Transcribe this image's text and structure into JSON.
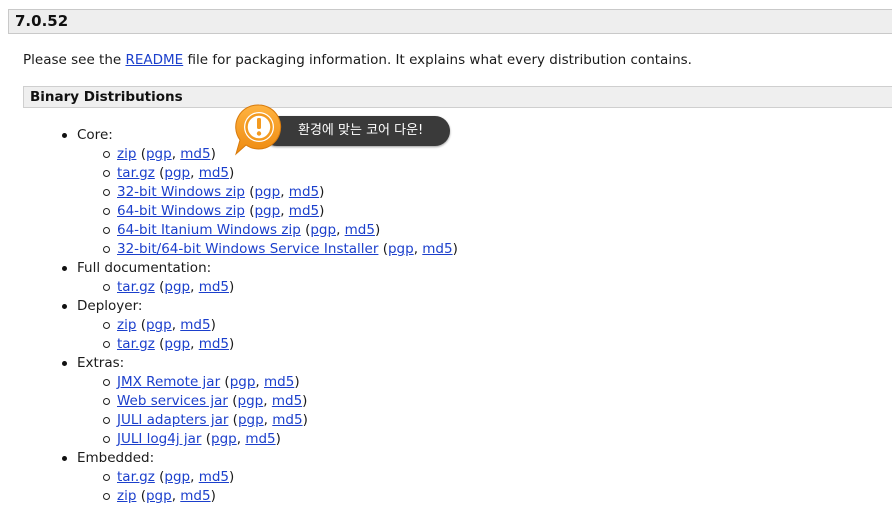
{
  "version_title": "7.0.52",
  "intro": {
    "before": "Please see the ",
    "link": "README",
    "after": " file for packaging information. It explains what every distribution contains."
  },
  "section_title": "Binary Distributions",
  "callout": {
    "text": "환경에 맞는 코어 다운!",
    "icon": "exclamation-icon",
    "accent": "#f39a1f"
  },
  "groups": [
    {
      "label": "Core:",
      "items": [
        {
          "name": "zip",
          "sig1": "pgp",
          "sig2": "md5"
        },
        {
          "name": "tar.gz",
          "sig1": "pgp",
          "sig2": "md5"
        },
        {
          "name": "32-bit Windows zip",
          "sig1": "pgp",
          "sig2": "md5"
        },
        {
          "name": "64-bit Windows zip",
          "sig1": "pgp",
          "sig2": "md5"
        },
        {
          "name": "64-bit Itanium Windows zip",
          "sig1": "pgp",
          "sig2": "md5"
        },
        {
          "name": "32-bit/64-bit Windows Service Installer",
          "sig1": "pgp",
          "sig2": "md5"
        }
      ]
    },
    {
      "label": "Full documentation:",
      "items": [
        {
          "name": "tar.gz",
          "sig1": "pgp",
          "sig2": "md5"
        }
      ]
    },
    {
      "label": "Deployer:",
      "items": [
        {
          "name": "zip",
          "sig1": "pgp",
          "sig2": "md5"
        },
        {
          "name": "tar.gz",
          "sig1": "pgp",
          "sig2": "md5"
        }
      ]
    },
    {
      "label": "Extras:",
      "items": [
        {
          "name": "JMX Remote jar",
          "sig1": "pgp",
          "sig2": "md5"
        },
        {
          "name": "Web services jar",
          "sig1": "pgp",
          "sig2": "md5"
        },
        {
          "name": "JULI adapters jar",
          "sig1": "pgp",
          "sig2": "md5"
        },
        {
          "name": "JULI log4j jar",
          "sig1": "pgp",
          "sig2": "md5"
        }
      ]
    },
    {
      "label": "Embedded:",
      "items": [
        {
          "name": "tar.gz",
          "sig1": "pgp",
          "sig2": "md5"
        },
        {
          "name": "zip",
          "sig1": "pgp",
          "sig2": "md5"
        }
      ]
    }
  ]
}
